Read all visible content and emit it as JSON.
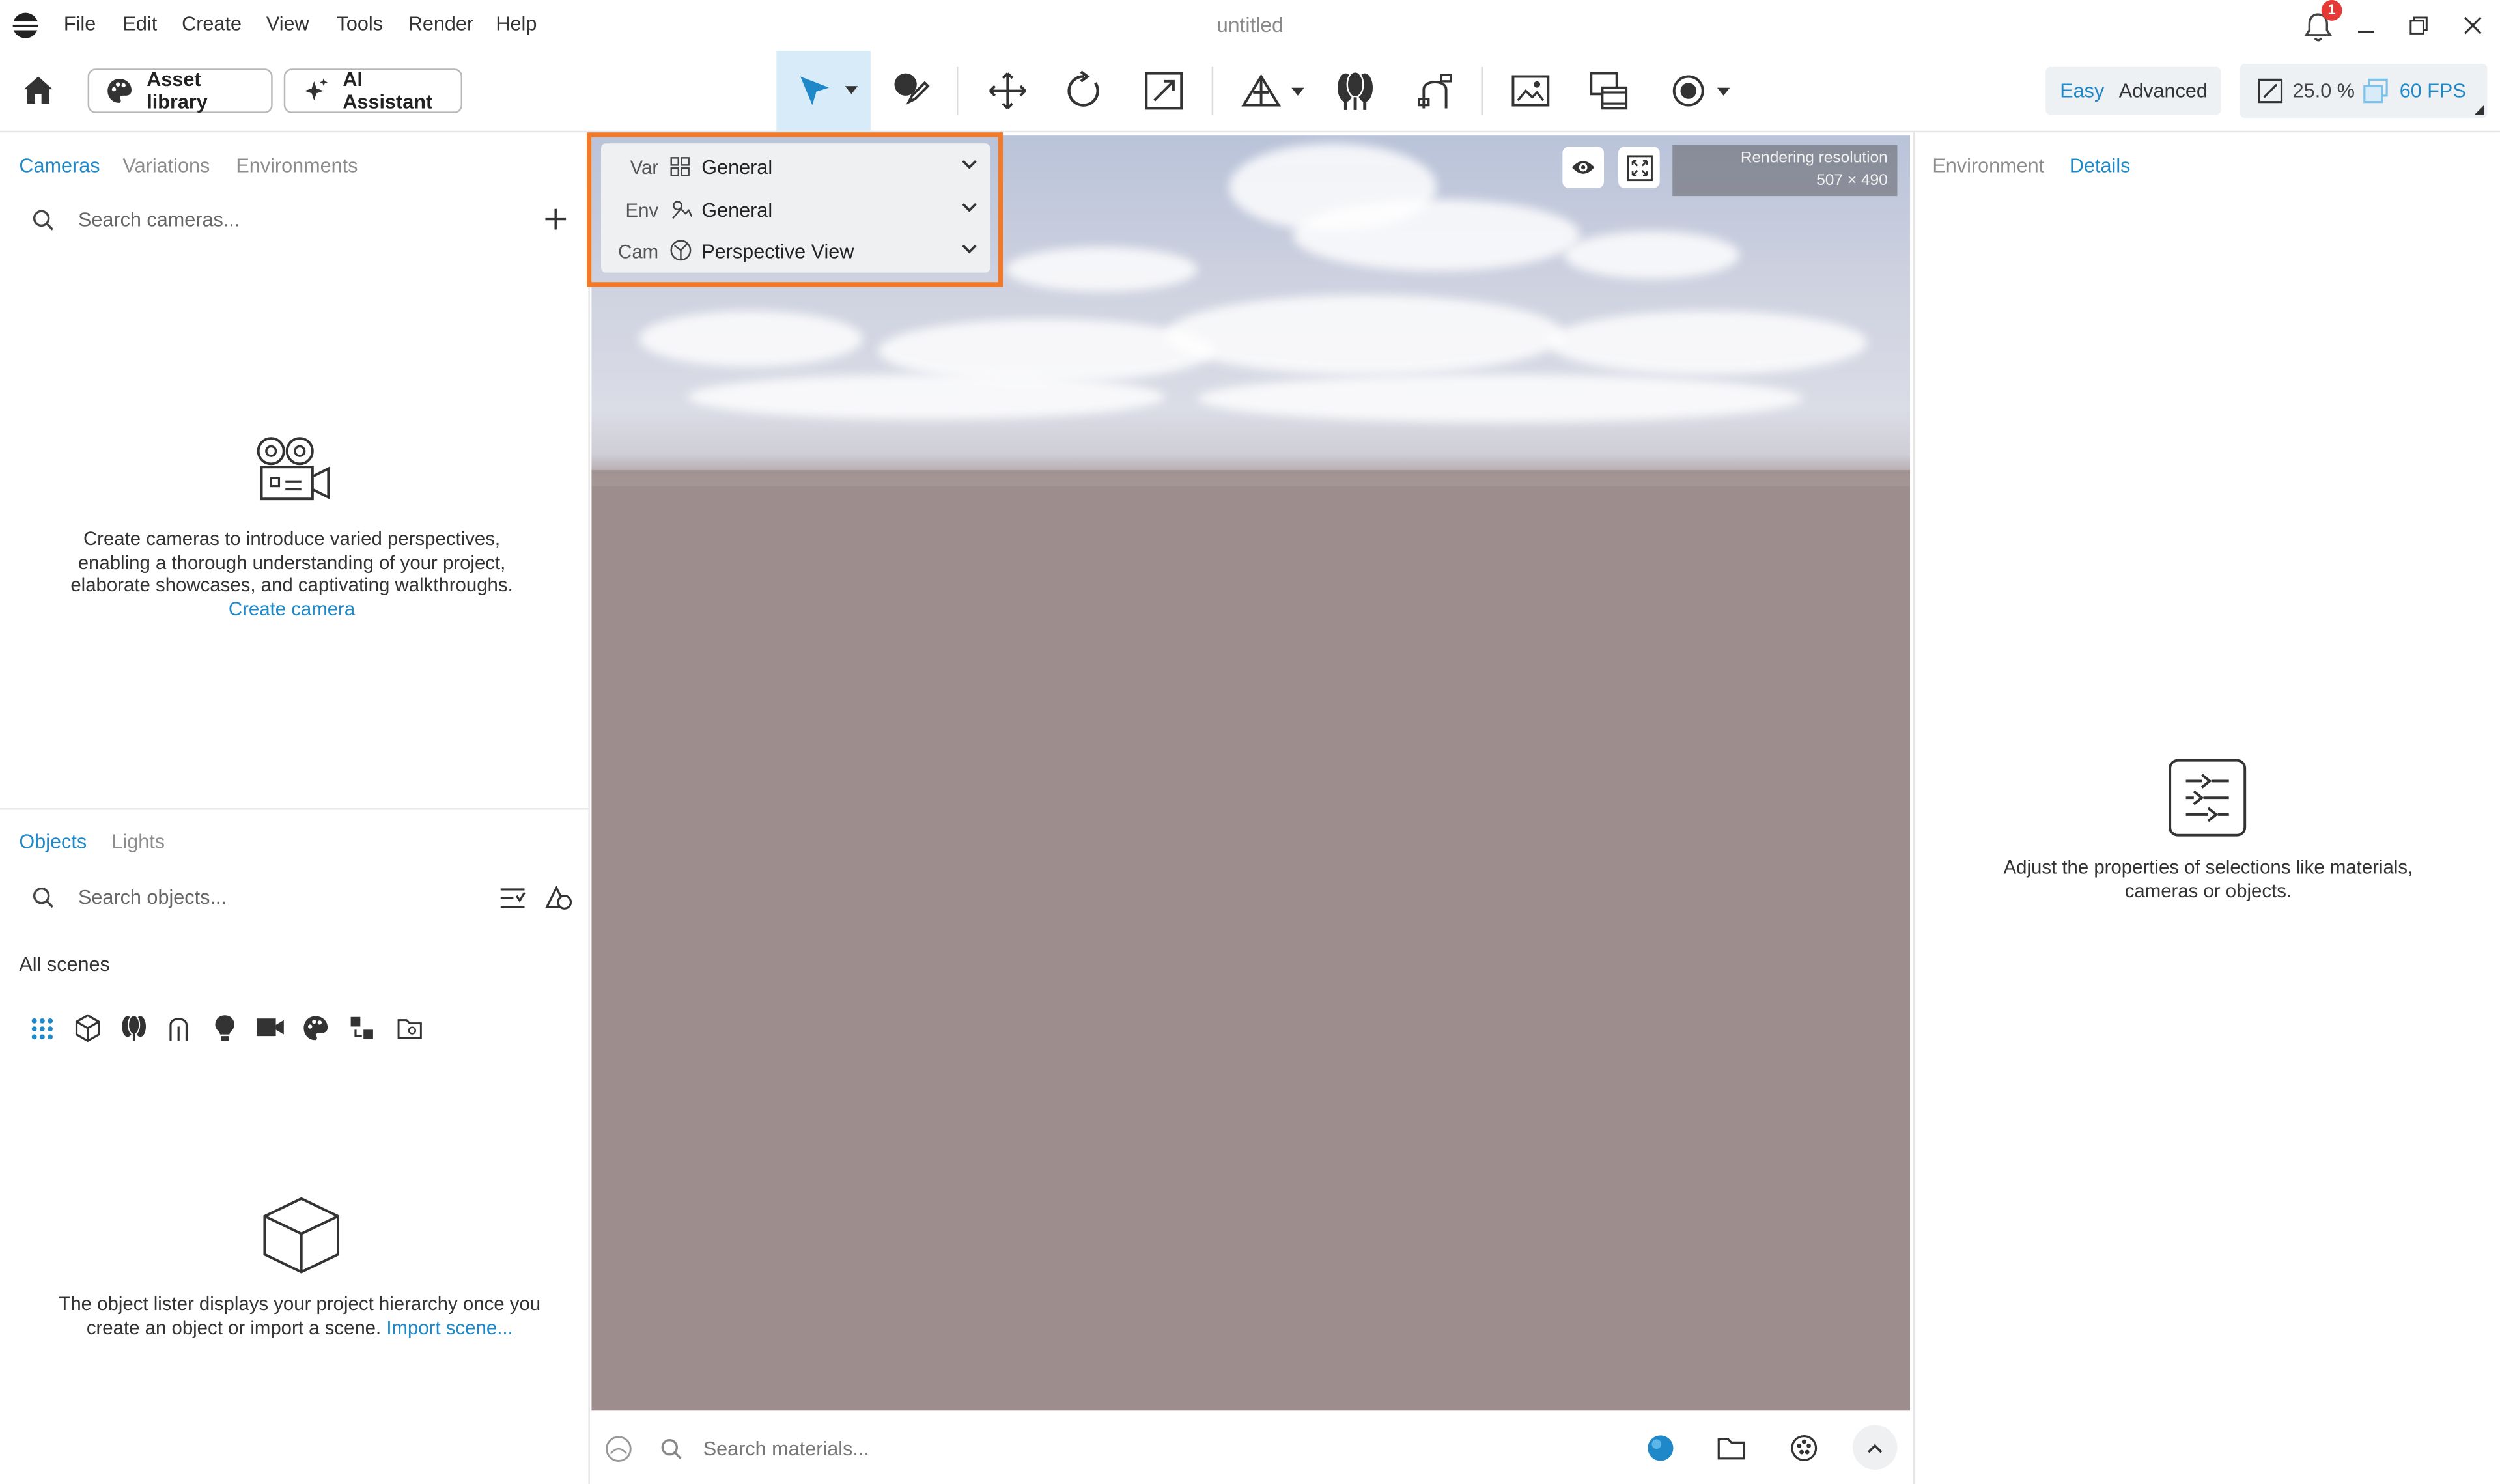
{
  "app": {
    "title": "untitled",
    "notification_count": "1"
  },
  "menu": {
    "items": [
      "File",
      "Edit",
      "Create",
      "View",
      "Tools",
      "Render",
      "Help"
    ]
  },
  "toolbar": {
    "asset_library": "Asset library",
    "ai_assistant": "AI Assistant",
    "mode_easy": "Easy",
    "mode_advanced": "Advanced",
    "zoom": "25.0 %",
    "fps": "60 FPS",
    "tools": [
      "select-tool",
      "paint-tool",
      "move-tool",
      "rotate-tool",
      "scale-tool",
      "terrain-tool",
      "vegetation-tool",
      "path-tool",
      "render-image-tool",
      "render-video-tool",
      "capture-tool"
    ]
  },
  "left_top": {
    "tabs": [
      "Cameras",
      "Variations",
      "Environments"
    ],
    "active_tab": "Cameras",
    "search_placeholder": "Search cameras...",
    "empty_line1": "Create cameras to introduce varied perspectives,",
    "empty_line2": "enabling a thorough understanding of your project,",
    "empty_line3": "elaborate showcases, and captivating walkthroughs.",
    "create_link": "Create camera"
  },
  "left_bottom": {
    "tabs": [
      "Objects",
      "Lights"
    ],
    "active_tab": "Objects",
    "search_placeholder": "Search objects...",
    "scope": "All scenes",
    "filter_icons": [
      "grid-icon",
      "cube-icon",
      "vegetation-icon",
      "path-icon",
      "light-icon",
      "video-camera-icon",
      "material-icon",
      "variation-icon",
      "folder-icon"
    ],
    "empty_line1": "The object lister displays your project hierarchy once you",
    "empty_line2": "create an object or import a scene.",
    "import_link": "Import scene..."
  },
  "viewport": {
    "dropdowns": [
      {
        "label": "Var",
        "value": "General",
        "icon": "variation-icon"
      },
      {
        "label": "Env",
        "value": "General",
        "icon": "environment-icon"
      },
      {
        "label": "Cam",
        "value": "Perspective View",
        "icon": "perspective-icon"
      }
    ],
    "resolution_label": "Rendering resolution",
    "resolution_value": "507 × 490"
  },
  "right_panel": {
    "tabs": [
      "Environment",
      "Details"
    ],
    "active_tab": "Details",
    "empty_line1": "Adjust the properties of selections like materials,",
    "empty_line2": "cameras or objects."
  },
  "material_bar": {
    "search_placeholder": "Search materials..."
  },
  "colors": {
    "accent": "#1e88c8",
    "highlight": "#f07a2a",
    "ground": "#9d8d8d"
  }
}
